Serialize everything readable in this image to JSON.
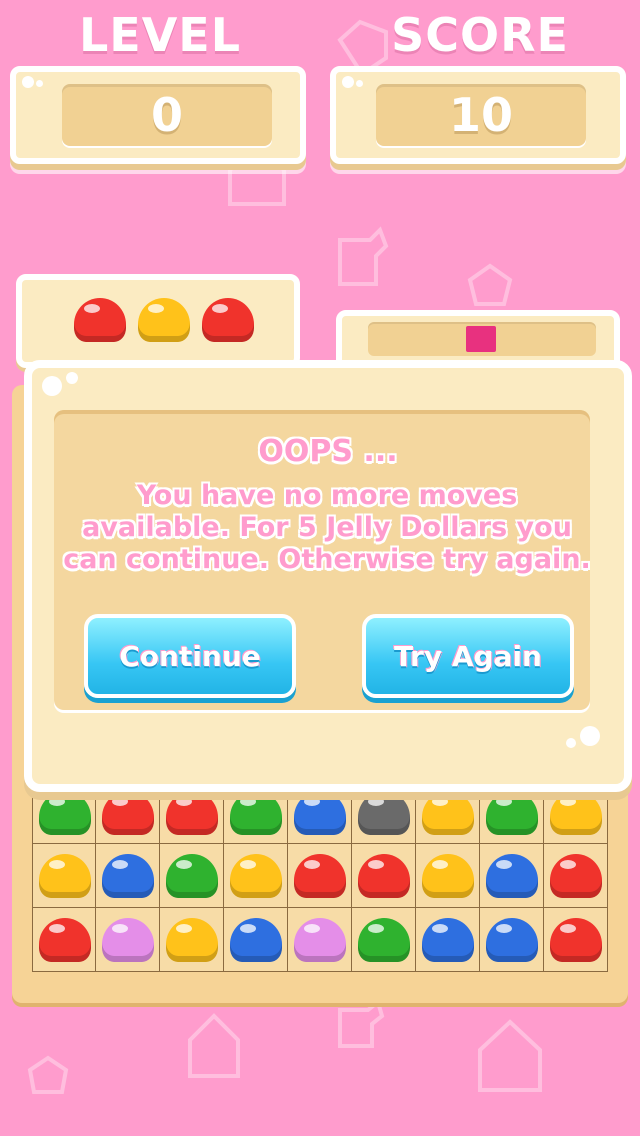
{
  "hud": {
    "level_label": "LEVEL",
    "level_value": "0",
    "score_label": "SCORE",
    "score_value": "10"
  },
  "goal": {
    "jellies": [
      "red",
      "yellow",
      "red"
    ]
  },
  "progress": {
    "fraction": 0.1,
    "color": "#e8317f"
  },
  "dialog": {
    "title": "OOPS ...",
    "message": "You have no more moves available. For 5 Jelly Dollars you can continue. Otherwise try again.",
    "continue_label": "Continue",
    "try_again_label": "Try Again"
  },
  "board": {
    "rows": [
      [
        "green",
        "red",
        "red",
        "green",
        "blue",
        "gray",
        "yellow",
        "green",
        "yellow"
      ],
      [
        "yellow",
        "blue",
        "green",
        "yellow",
        "red",
        "red",
        "yellow",
        "blue",
        "red"
      ],
      [
        "red",
        "pink",
        "yellow",
        "blue",
        "pink",
        "green",
        "blue",
        "blue",
        "red"
      ]
    ]
  },
  "colors": {
    "red": "#f0332c",
    "yellow": "#ffc21a",
    "green": "#2fb22f",
    "blue": "#2e6fe0",
    "gray": "#6a6a6a",
    "pink": "#e48ee8",
    "background": "#ff9ccd",
    "accent": "#37c6f4"
  }
}
